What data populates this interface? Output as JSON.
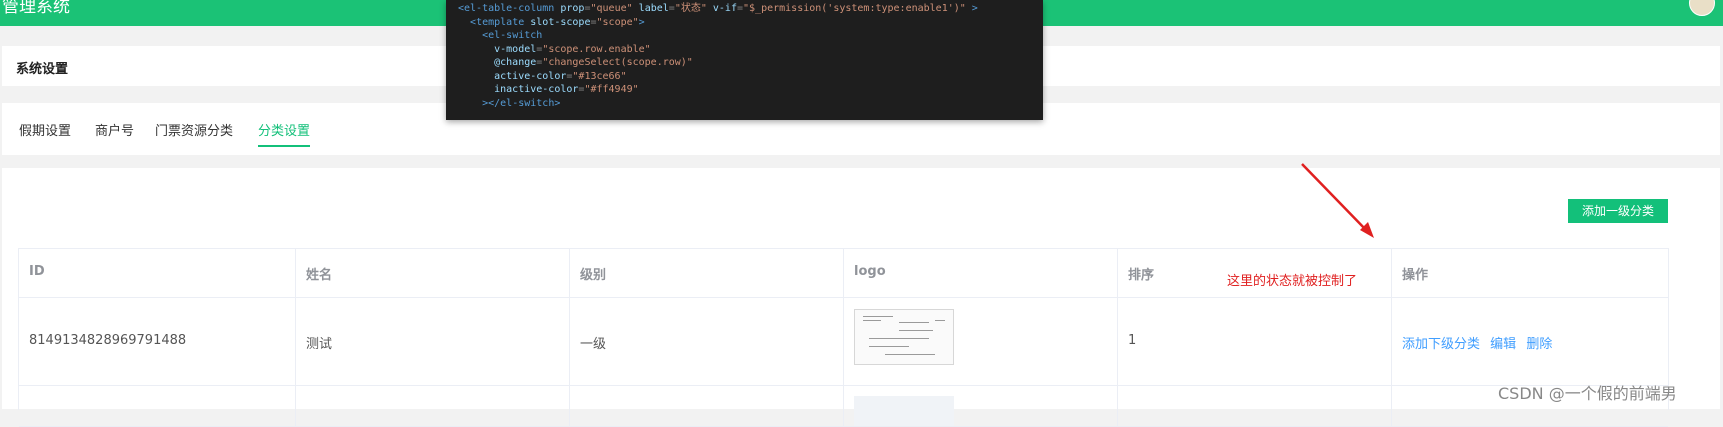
{
  "app": {
    "title": "管理系统"
  },
  "section": {
    "title": "系统设置"
  },
  "tabs": [
    {
      "label": "假期设置",
      "active": false
    },
    {
      "label": "商户号",
      "active": false
    },
    {
      "label": "门票资源分类",
      "active": false
    },
    {
      "label": "分类设置",
      "active": true
    }
  ],
  "toolbar": {
    "add_label": "添加一级分类"
  },
  "table": {
    "headers": [
      "ID",
      "姓名",
      "级别",
      "logo",
      "排序",
      "操作"
    ],
    "rows": [
      {
        "id": "8149134828969791488",
        "name": "测试",
        "level": "一级",
        "sort": "1",
        "actions": [
          "添加下级分类",
          "编辑",
          "删除"
        ]
      }
    ]
  },
  "annotation": {
    "text": "这里的状态就被控制了"
  },
  "code_lines": [
    {
      "indent": "",
      "parts": [
        [
          "tag",
          "<el-table-column "
        ],
        [
          "attr",
          "prop"
        ],
        [
          "punc",
          "="
        ],
        [
          "str",
          "\"queue\""
        ],
        [
          "txt",
          " "
        ],
        [
          "attr",
          "label"
        ],
        [
          "punc",
          "="
        ],
        [
          "str",
          "\"状态\""
        ],
        [
          "txt",
          " "
        ],
        [
          "attr",
          "v-if"
        ],
        [
          "punc",
          "="
        ],
        [
          "str",
          "\"$_permission('system:type:enable1')\""
        ],
        [
          "tag",
          " >"
        ]
      ]
    },
    {
      "indent": "  ",
      "parts": [
        [
          "tag",
          "<template "
        ],
        [
          "attr",
          "slot-scope"
        ],
        [
          "punc",
          "="
        ],
        [
          "str",
          "\"scope\""
        ],
        [
          "tag",
          ">"
        ]
      ]
    },
    {
      "indent": "    ",
      "parts": [
        [
          "tag",
          "<el-switch"
        ]
      ]
    },
    {
      "indent": "      ",
      "parts": [
        [
          "attr",
          "v-model"
        ],
        [
          "punc",
          "="
        ],
        [
          "str",
          "\"scope.row.enable\""
        ]
      ]
    },
    {
      "indent": "      ",
      "parts": [
        [
          "attr",
          "@change"
        ],
        [
          "punc",
          "="
        ],
        [
          "str",
          "\"changeSelect(scope.row)\""
        ]
      ]
    },
    {
      "indent": "      ",
      "parts": [
        [
          "attr",
          "active-color"
        ],
        [
          "punc",
          "="
        ],
        [
          "str",
          "\"#13ce66\""
        ]
      ]
    },
    {
      "indent": "      ",
      "parts": [
        [
          "attr",
          "inactive-color"
        ],
        [
          "punc",
          "="
        ],
        [
          "str",
          "\"#ff4949\""
        ]
      ]
    },
    {
      "indent": "    ",
      "parts": [
        [
          "tag",
          "></el-switch>"
        ]
      ]
    }
  ],
  "watermark": {
    "text": "CSDN @一个假的前端男"
  },
  "colors": {
    "primary": "#13c07a",
    "link": "#409eff",
    "annotation": "#e02020",
    "code_bg": "#1e1e1e"
  }
}
